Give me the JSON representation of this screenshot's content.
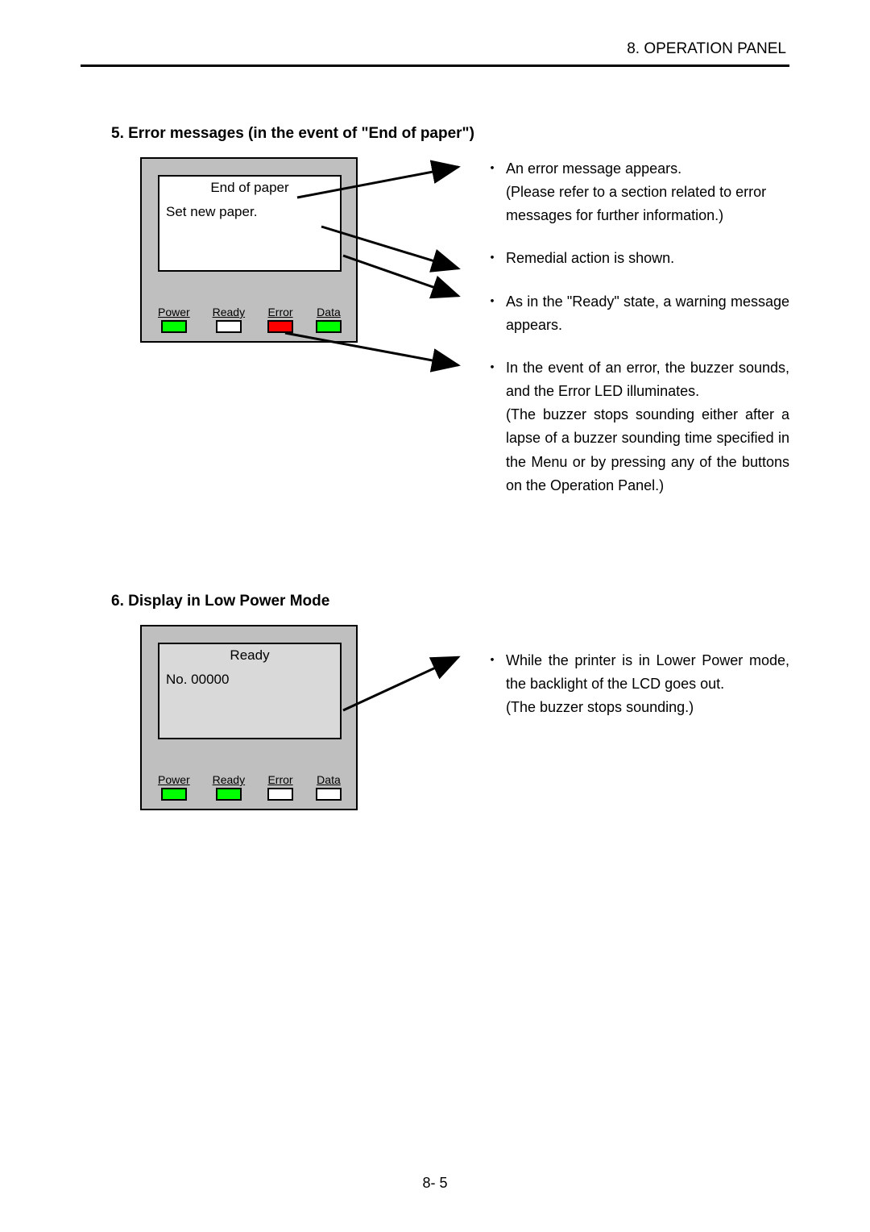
{
  "header": {
    "chapter": "8.  OPERATION  PANEL"
  },
  "section5": {
    "num_title": "5.    Error messages (in the event of \"End of paper\")",
    "lcd_line1": "End of paper",
    "lcd_line2": "Set new paper.",
    "leds": {
      "power": "Power",
      "ready": "Ready",
      "error": "Error",
      "data": "Data"
    },
    "d1": "An error message appears.",
    "d1b": "(Please refer to a section related to error messages for further information.)",
    "d2": "Remedial action is shown.",
    "d3": "As in the \"Ready\" state, a warning message appears.",
    "d4": "In the event of an error, the buzzer sounds, and the Error LED illuminates.",
    "d4b": "(The buzzer stops sounding either after a lapse of a buzzer sounding time specified in the Menu or by pressing any of the buttons on the Operation Panel.)"
  },
  "section6": {
    "num_title": "6.    Display in Low Power Mode",
    "lcd_line1": "Ready",
    "lcd_line2": "No. 00000",
    "leds": {
      "power": "Power",
      "ready": "Ready",
      "error": "Error",
      "data": "Data"
    },
    "d1": "While the printer is in Lower Power mode, the backlight of the LCD goes out.",
    "d1b": "(The buzzer stops sounding.)"
  },
  "footer": {
    "page": "8- 5"
  }
}
